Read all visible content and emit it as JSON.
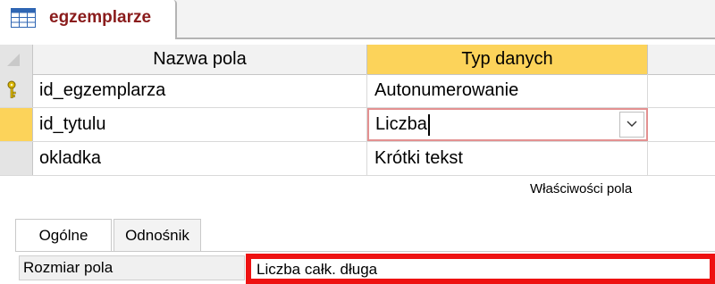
{
  "document_tab": {
    "title": "egzemplarze",
    "icon": "table-icon"
  },
  "grid": {
    "columns": {
      "name": "Nazwa pola",
      "type": "Typ danych"
    },
    "rows": [
      {
        "name": "id_egzemplarza",
        "type": "Autonumerowanie",
        "primary_key": true,
        "selected": false
      },
      {
        "name": "id_tytulu",
        "type": "Liczba",
        "primary_key": false,
        "selected": true
      },
      {
        "name": "okladka",
        "type": "Krótki tekst",
        "primary_key": false,
        "selected": false
      }
    ]
  },
  "properties": {
    "title": "Właściwości pola",
    "tabs": [
      "Ogólne",
      "Odnośnik"
    ],
    "active_tab": "Ogólne",
    "field_size": {
      "label": "Rozmiar pola",
      "value": "Liczba całk. długa"
    }
  },
  "colors": {
    "header_highlight": "#fcd35a",
    "tab_text": "#8a1c1c",
    "highlight_box": "#ee1111"
  }
}
